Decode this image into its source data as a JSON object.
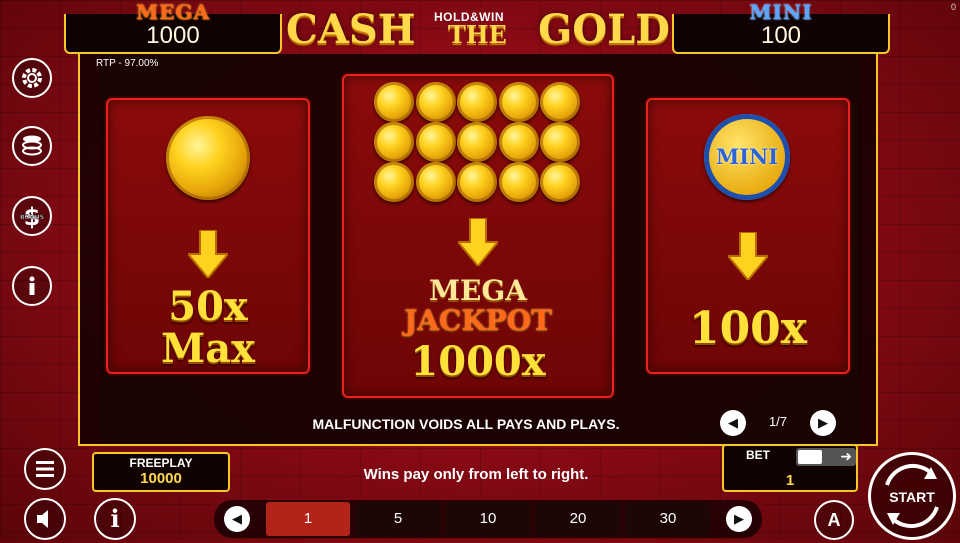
{
  "corner_indicator": "0",
  "jackpots": {
    "mega": {
      "title": "MEGA",
      "value": "1000"
    },
    "mini": {
      "title": "MINI",
      "value": "100"
    }
  },
  "logo": {
    "word1": "CASH",
    "subtitle": "HOLD&WIN",
    "word2": "THE",
    "word3": "GOLD"
  },
  "rtp": "RTP - 97.00%",
  "side_icons": [
    "gear-icon",
    "coin-stack-icon",
    "bonus-dollar-icon",
    "info-icon"
  ],
  "bonus_badge_text": "BONUS",
  "panels": {
    "left": {
      "icon": "gold-coin-icon",
      "line1": "50x",
      "line2": "Max"
    },
    "center": {
      "coin_rows": 3,
      "coin_cols": 5,
      "line1": "MEGA",
      "line2": "JACKPOT",
      "line3": "1000x"
    },
    "right": {
      "coin_label": "MINI",
      "line1": "100x"
    }
  },
  "malfunction_text": "MALFUNCTION VOIDS ALL PAYS AND PLAYS.",
  "pager": {
    "current": "1/7"
  },
  "freeplay": {
    "label": "FREEPLAY",
    "value": "10000"
  },
  "wins_text": "Wins pay only from left to right.",
  "bet": {
    "label": "BET",
    "value": "1"
  },
  "bet_options": [
    {
      "label": "1",
      "active": true
    },
    {
      "label": "5",
      "active": false
    },
    {
      "label": "10",
      "active": false
    },
    {
      "label": "20",
      "active": false
    },
    {
      "label": "30",
      "active": false
    }
  ],
  "auto_label": "A",
  "start_label": "START",
  "colors": {
    "gold": "#f7c72a",
    "red_panel": "#8b0b0b",
    "mega_orange": "#ff6a1a",
    "mini_blue": "#5aa6ff"
  }
}
